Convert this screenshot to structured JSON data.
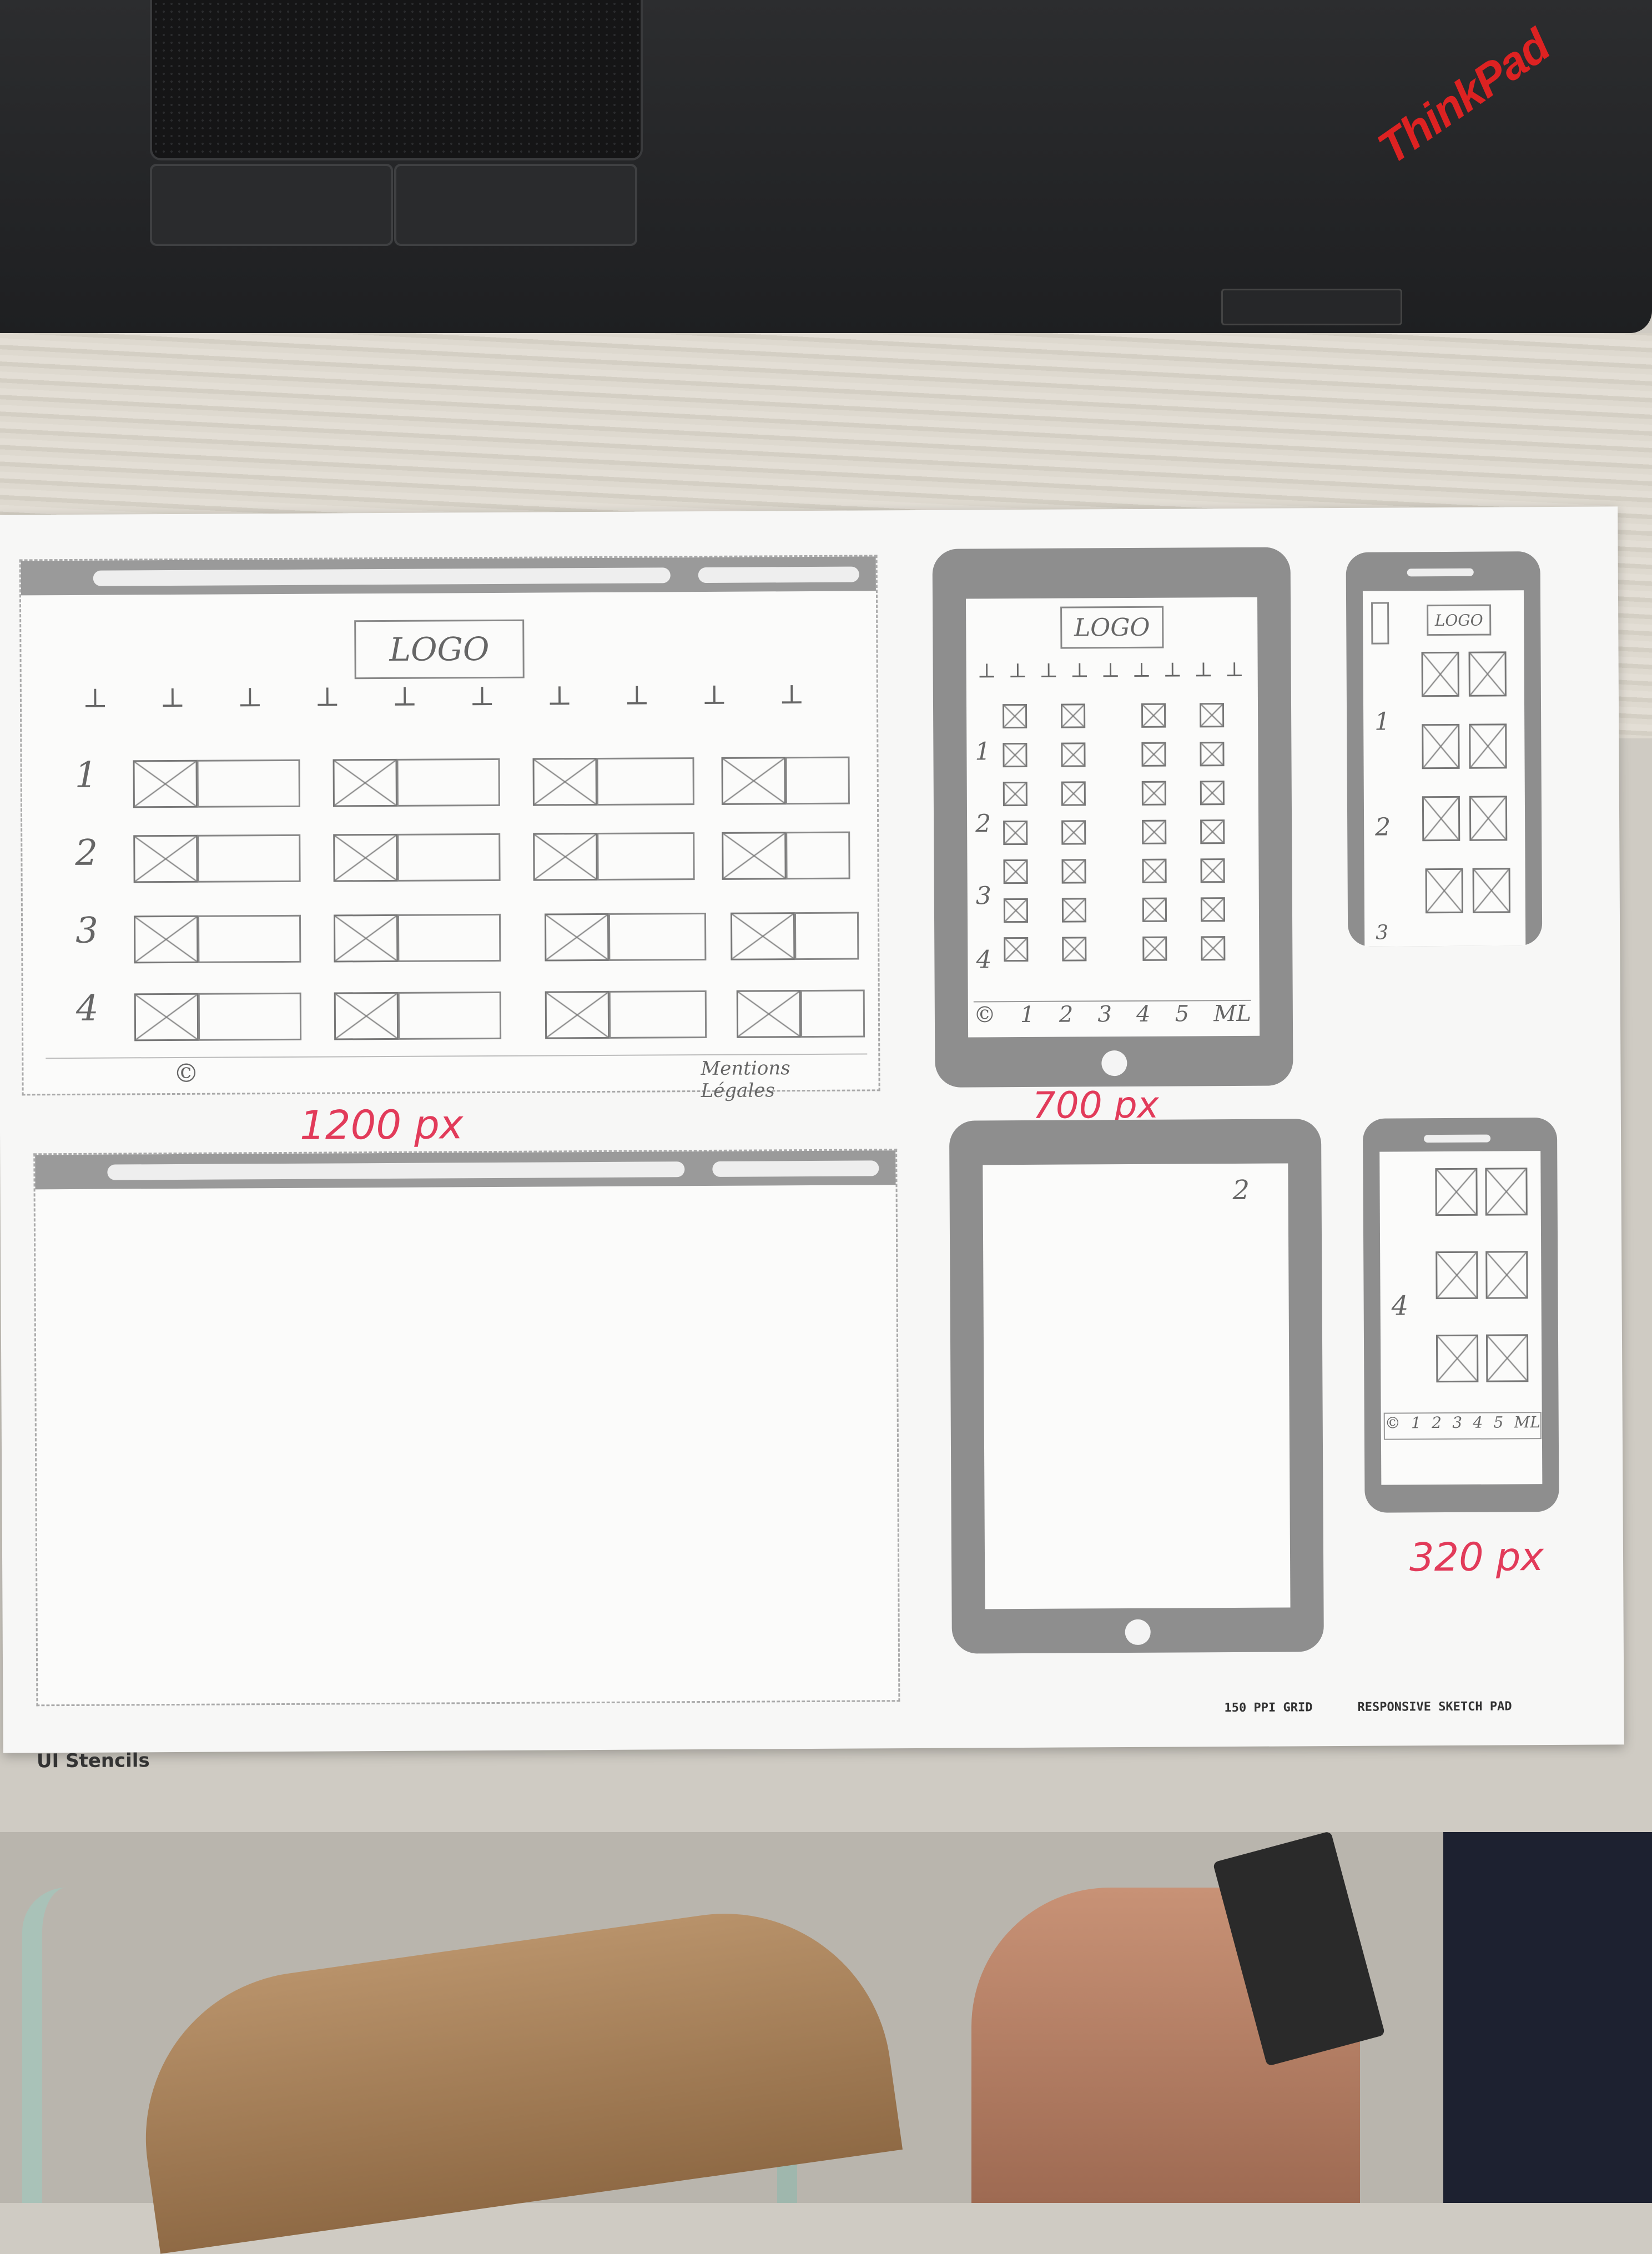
{
  "laptop": {
    "brand": "ThinkPad"
  },
  "sketchpad": {
    "brand": "UI Stencils",
    "grid_label": "150 PPI GRID",
    "pad_label": "RESPONSIVE SKETCH PAD"
  },
  "desktop_wireframe": {
    "logo": "LOGO",
    "row_numbers": [
      "1",
      "2",
      "3",
      "4"
    ],
    "footer_copyright": "©",
    "footer_text": "Mentions Légales",
    "width_label": "1200 px"
  },
  "tablet_wireframe": {
    "logo": "LOGO",
    "row_numbers": [
      "1",
      "2",
      "3",
      "4"
    ],
    "pagination": [
      "©",
      "1",
      "2",
      "3",
      "4",
      "5",
      "ML"
    ],
    "width_label": "700 px"
  },
  "phone_wireframe": {
    "logo": "LOGO",
    "row_numbers": [
      "1",
      "2",
      "3"
    ],
    "width_label": "320 px"
  },
  "phone_wireframe_2": {
    "row_numbers": [
      "4"
    ],
    "pagination": [
      "©",
      "1",
      "2",
      "3",
      "4",
      "5",
      "ML"
    ]
  },
  "tablet_wireframe_2": {
    "mark": "2"
  }
}
